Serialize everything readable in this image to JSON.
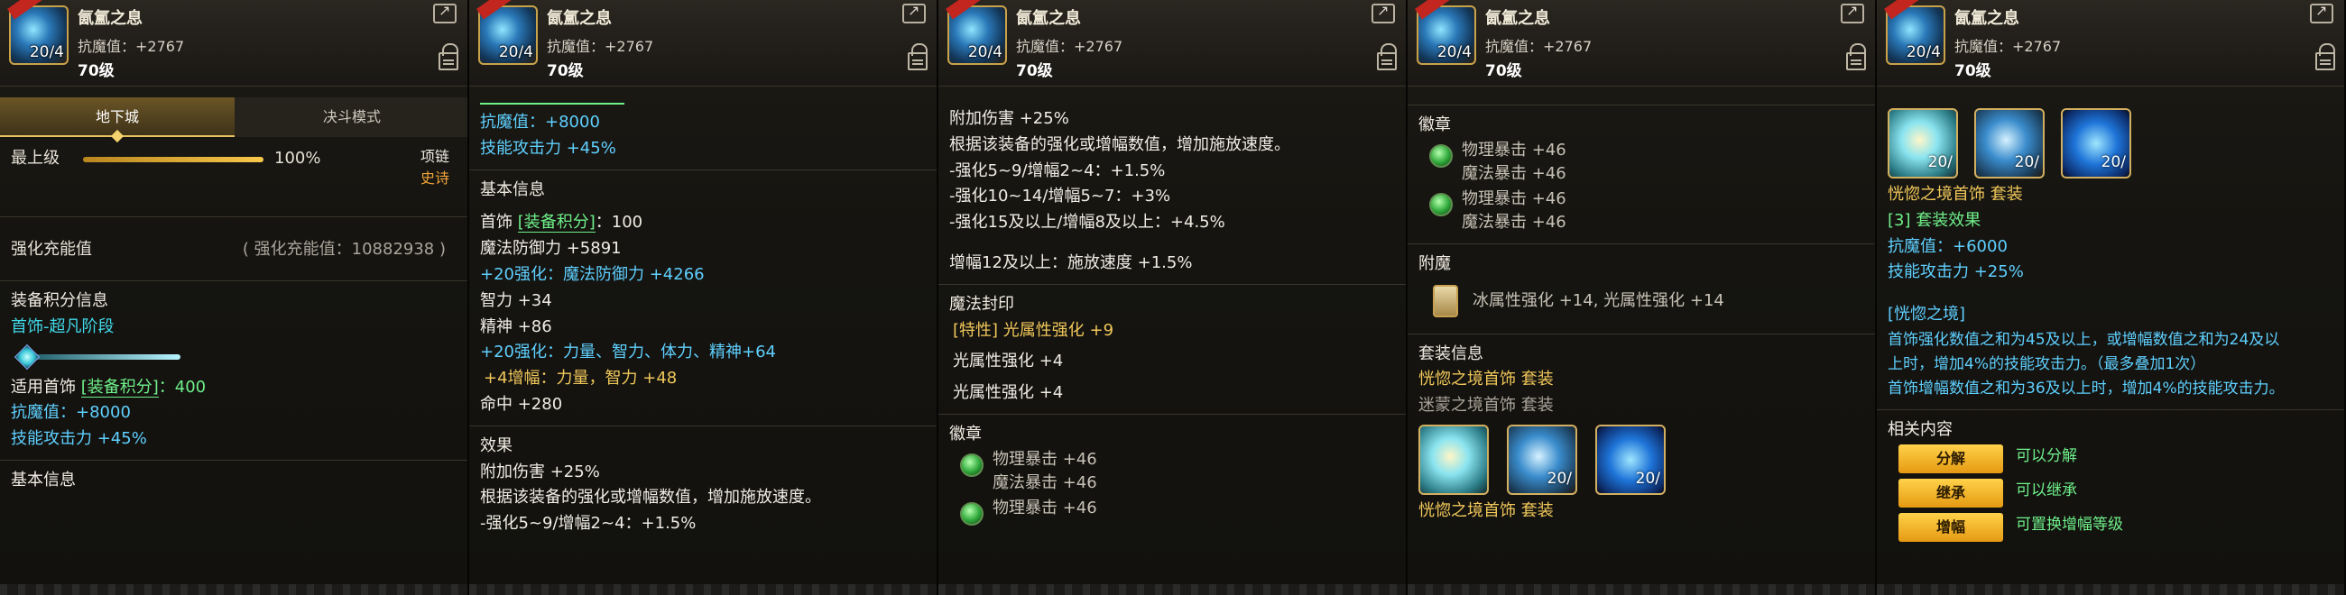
{
  "header": {
    "name": "氤氲之息",
    "resist": "抗魔值：+2767",
    "level": "70级",
    "icon_level": "20/4"
  },
  "panel1": {
    "tabs": [
      "地下城",
      "决斗模式"
    ],
    "max_label": "最上级",
    "max_percent": "100%",
    "max_progress": 1.0,
    "slot_type": "项链",
    "rarity": "史诗",
    "charge_label": "强化充能值",
    "charge_value": "( 强化充能值：10882938 )",
    "equip_score_title": "装备积分信息",
    "stage_label": "首饰-超凡阶段",
    "apply_label": "适用首饰",
    "apply_tag": "[装备积分]",
    "apply_value": "：400",
    "resist": "抗魔值：+8000",
    "skill_atk": "技能攻击力 +45%",
    "basic_info": "基本信息"
  },
  "panel2": {
    "resist": "抗魔值：+8000",
    "skill_atk": "技能攻击力 +45%",
    "basic_info": "基本信息",
    "acc_label": "首饰",
    "acc_tag": "[装备积分]",
    "acc_value": "：100",
    "mdef": "魔法防御力 +5891",
    "enh_mdef": "+20强化：魔法防御力 +4266",
    "int": "智力 +34",
    "spirit": "精神 +86",
    "enh_stats": "+20强化：力量、智力、体力、精神+64",
    "amp_stats": "+4增幅：力量，智力 +48",
    "hit": "命中 +280",
    "effect_title": "效果",
    "effect1": "附加伤害 +25%",
    "effect2": "根据该装备的强化或增幅数值，增加施放速度。",
    "effect3": "-强化5~9/增幅2~4：+1.5%"
  },
  "panel3": {
    "effect1": "附加伤害 +25%",
    "effect2": "根据该装备的强化或增幅数值，增加施放速度。",
    "effect3": "-强化5~9/增幅2~4：+1.5%",
    "effect4": "-强化10~14/增幅5~7：+3%",
    "effect5": "-强化15及以上/增幅8及以上：+4.5%",
    "effect6": "增幅12及以上：施放速度 +1.5%",
    "seal_title": "魔法封印",
    "seal1": "[特性] 光属性强化 +9",
    "seal2": "光属性强化 +4",
    "seal3": "光属性强化 +4",
    "emblem_title": "徽章",
    "emblem1a": "物理暴击 +46",
    "emblem1b": "魔法暴击 +46",
    "emblem2a": "物理暴击 +46"
  },
  "panel4": {
    "emblem_title": "徽章",
    "emblem1a": "物理暴击 +46",
    "emblem1b": "魔法暴击 +46",
    "emblem2a": "物理暴击 +46",
    "emblem2b": "魔法暴击 +46",
    "enchant_title": "附魔",
    "enchant_text": "冰属性强化 +14, 光属性强化 +14",
    "set_title": "套装信息",
    "set1": "恍惚之境首饰 套装",
    "set2": "迷蒙之境首饰 套装",
    "set_footer": "恍惚之境首饰 套装",
    "thumb_levels": [
      "",
      "20/",
      "20/"
    ]
  },
  "panel5": {
    "thumb_levels": [
      "20/",
      "20/",
      "20/"
    ],
    "set_name": "恍惚之境首饰 套装",
    "set_effect": "[3] 套装效果",
    "resist": "抗魔值：+6000",
    "skill_atk": "技能攻击力 +25%",
    "realm_title": "[恍惚之境]",
    "realm1": "首饰强化数值之和为45及以上，或增幅数值之和为24及以",
    "realm2": "上时，增加4%的技能攻击力。（最多叠加1次）",
    "realm3": "首饰增幅数值之和为36及以上时，增加4%的技能攻击力。",
    "related_title": "相关内容",
    "buttons": [
      {
        "label": "分解",
        "desc": "可以分解"
      },
      {
        "label": "继承",
        "desc": "可以继承"
      },
      {
        "label": "增幅",
        "desc": "可置换增幅等级"
      }
    ]
  }
}
